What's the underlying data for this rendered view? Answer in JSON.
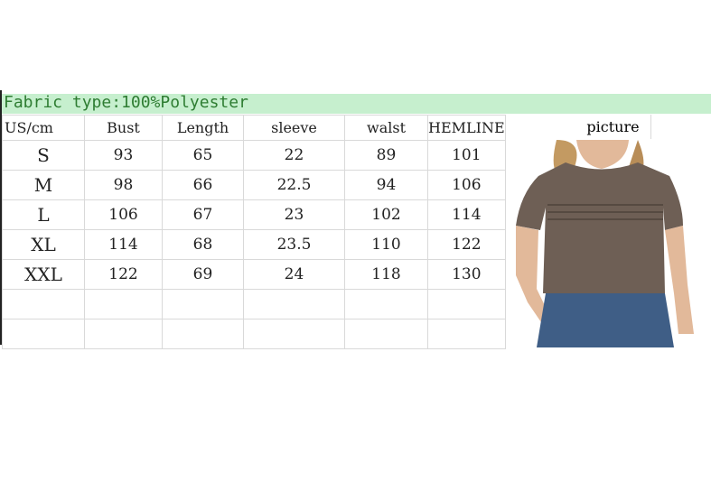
{
  "title": "Fabric type:100%Polyester",
  "columns": [
    "US/cm",
    "Bust",
    "Length",
    "sleeve",
    "walst",
    "HEMLINE"
  ],
  "picture_label": "picture",
  "rows": [
    [
      "S",
      "93",
      "65",
      "22",
      "89",
      "101"
    ],
    [
      "M",
      "98",
      "66",
      "22.5",
      "94",
      "106"
    ],
    [
      "L",
      "106",
      "67",
      "23",
      "102",
      "114"
    ],
    [
      "XL",
      "114",
      "68",
      "23.5",
      "110",
      "122"
    ],
    [
      "XXL",
      "122",
      "69",
      "24",
      "118",
      "130"
    ]
  ],
  "colors": {
    "band": "#c6efce",
    "title": "#2e7d32",
    "shirt": "#6e5f55",
    "jeans": "#3f5e86"
  }
}
